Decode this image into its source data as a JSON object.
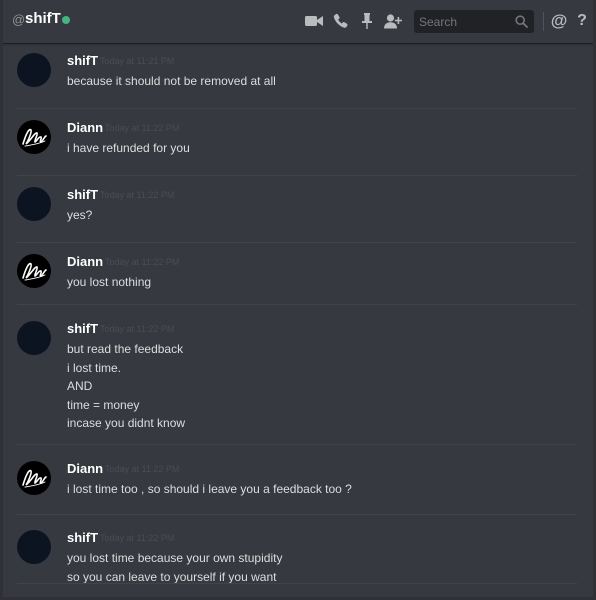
{
  "header": {
    "at_symbol": "@",
    "channel_name": "shifT",
    "status": "online",
    "status_color": "#43b581",
    "icons": [
      "video-call-icon",
      "voice-call-icon",
      "pinned-messages-icon",
      "add-friend-icon",
      "mention-icon",
      "help-icon"
    ],
    "search_placeholder": "Search",
    "mention_label": "@",
    "help_label": "?"
  },
  "messages": [
    {
      "author": "shifT",
      "avatar": "dark-blue-avatar",
      "timestamp": "Today at 11:21 PM",
      "lines": [
        "because it should not be removed at all"
      ]
    },
    {
      "author": "Diann",
      "avatar": "diann-signature-avatar",
      "timestamp": "Today at 11:22 PM",
      "lines": [
        "i have refunded for you"
      ]
    },
    {
      "author": "shifT",
      "avatar": "dark-blue-avatar",
      "timestamp": "Today at 11:22 PM",
      "lines": [
        "yes?"
      ]
    },
    {
      "author": "Diann",
      "avatar": "diann-signature-avatar",
      "timestamp": "Today at 11:22 PM",
      "lines": [
        "you lost nothing"
      ]
    },
    {
      "author": "shifT",
      "avatar": "dark-blue-avatar",
      "timestamp": "Today at 11:22 PM",
      "lines": [
        "but read the feedback",
        "i lost time.",
        "AND",
        "time = money",
        "incase you didnt know"
      ]
    },
    {
      "author": "Diann",
      "avatar": "diann-signature-avatar",
      "timestamp": "Today at 11:22 PM",
      "lines": [
        "i lost time too , so should i leave you a feedback too ?"
      ]
    },
    {
      "author": "shifT",
      "avatar": "dark-blue-avatar",
      "timestamp": "Today at 11:22 PM",
      "lines": [
        "you lost time because your own stupidity",
        "so you can leave to yourself if you want"
      ]
    }
  ]
}
